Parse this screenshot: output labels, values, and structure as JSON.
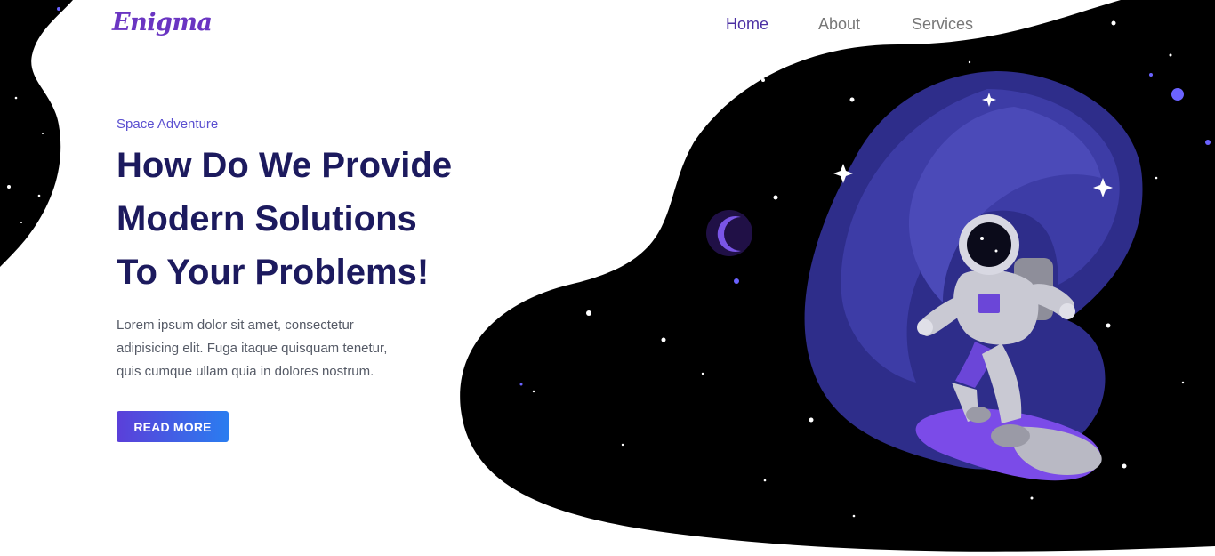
{
  "header": {
    "logo": "Enigma",
    "nav": [
      {
        "label": "Home",
        "active": true
      },
      {
        "label": "About",
        "active": false
      },
      {
        "label": "Services",
        "active": false
      }
    ]
  },
  "hero": {
    "eyebrow": "Space Adventure",
    "headline": [
      "How Do We Provide",
      "Modern Solutions",
      "To Your Problems!"
    ],
    "description": [
      "Lorem ipsum dolor sit amet, consectetur",
      "adipisicing elit. Fuga itaque quisquam tenetur,",
      "quis cumque ullam quia in dolores nostrum."
    ],
    "cta_label": "READ MORE"
  },
  "colors": {
    "brand": "#6a35c2",
    "nav_active": "#4b2fa3",
    "headline": "#1c1a5e",
    "space": "#000000",
    "galaxy": "#2e2d8a"
  },
  "illustration": {
    "icons": [
      "moon-icon",
      "astronaut-icon",
      "surfboard-icon",
      "star-icon"
    ]
  }
}
